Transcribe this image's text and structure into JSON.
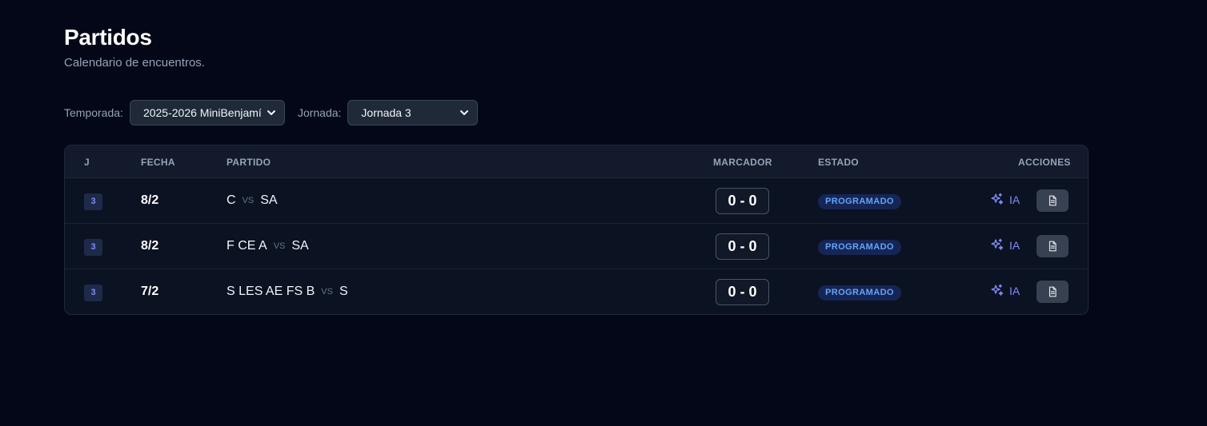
{
  "header": {
    "title": "Partidos",
    "subtitle": "Calendario de encuentros."
  },
  "filters": {
    "temporada_label": "Temporada:",
    "temporada_value": "2025-2026 MiniBenjamí",
    "jornada_label": "Jornada:",
    "jornada_value": "Jornada 3"
  },
  "table": {
    "columns": {
      "j": "J",
      "fecha": "FECHA",
      "partido": "PARTIDO",
      "marcador": "MARCADOR",
      "estado": "ESTADO",
      "acciones": "ACCIONES"
    },
    "rows": [
      {
        "jornada": "3",
        "fecha": "8/2",
        "local": "C",
        "vs": "VS",
        "visitante": "SA",
        "marcador": "0 - 0",
        "estado": "PROGRAMADO",
        "ia_label": "IA"
      },
      {
        "jornada": "3",
        "fecha": "8/2",
        "local": "F CE A",
        "vs": "VS",
        "visitante": "SA",
        "marcador": "0 - 0",
        "estado": "PROGRAMADO",
        "ia_label": "IA"
      },
      {
        "jornada": "3",
        "fecha": "7/2",
        "local": "S LES AE FS B",
        "vs": "VS",
        "visitante": "S",
        "marcador": "0 - 0",
        "estado": "PROGRAMADO",
        "ia_label": "IA"
      }
    ]
  },
  "icons": {
    "select_arrow": "chevron-down-icon",
    "ai": "sparkles-icon",
    "report": "document-icon"
  },
  "colors": {
    "background": "#030717",
    "accent": "#818cf8",
    "status": "#60a5fa"
  }
}
